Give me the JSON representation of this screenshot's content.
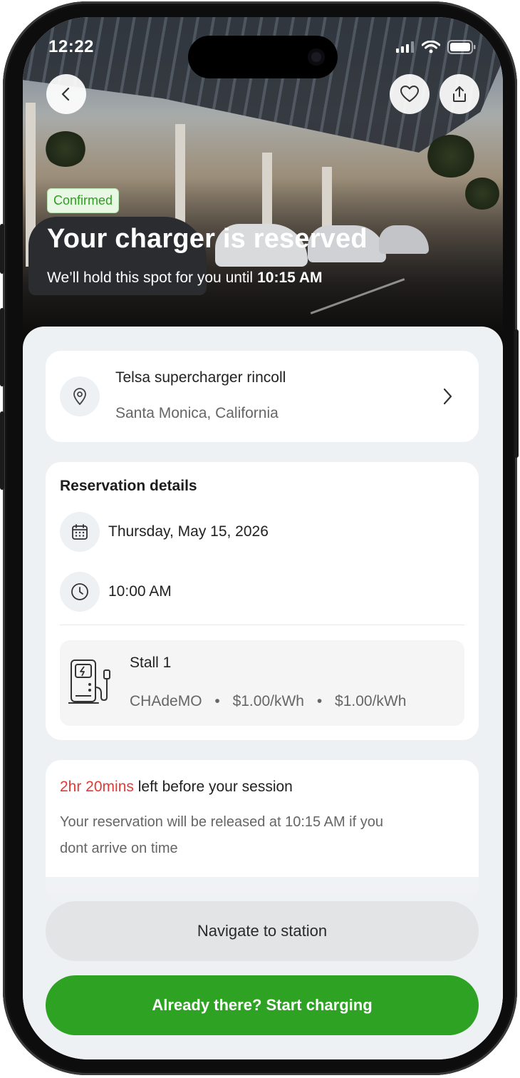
{
  "status_bar": {
    "time": "12:22"
  },
  "hero": {
    "badge": "Confirmed",
    "title": "Your charger is reserved",
    "subtitle": "We’ll hold this spot for you until",
    "hold_until": "10:15 AM",
    "icons": {
      "back": "chevron-left-icon",
      "favorite": "heart-icon",
      "share": "share-icon"
    }
  },
  "station": {
    "name": "Telsa supercharger rincoll",
    "location": "Santa Monica, California"
  },
  "reservation": {
    "heading": "Reservation details",
    "date": "Thursday, May 15, 2026",
    "time": "10:00 AM",
    "stall": {
      "name": "Stall 1",
      "connector": "CHAdeMO",
      "price1": "$1.00/kWh",
      "price2": "$1.00/kWh",
      "separator": "•"
    }
  },
  "countdown": {
    "remaining": "2hr 20mins",
    "label": "left before your session",
    "note_line1": "Your reservation will be released at 10:15 AM  if you",
    "note_line2": "dont arrive on time"
  },
  "actions": {
    "navigate": "Navigate to station",
    "start": "Already there? Start charging"
  },
  "colors": {
    "accent_green": "#2ea323",
    "countdown_red": "#e53935",
    "badge_bg": "#e8f8e4"
  }
}
